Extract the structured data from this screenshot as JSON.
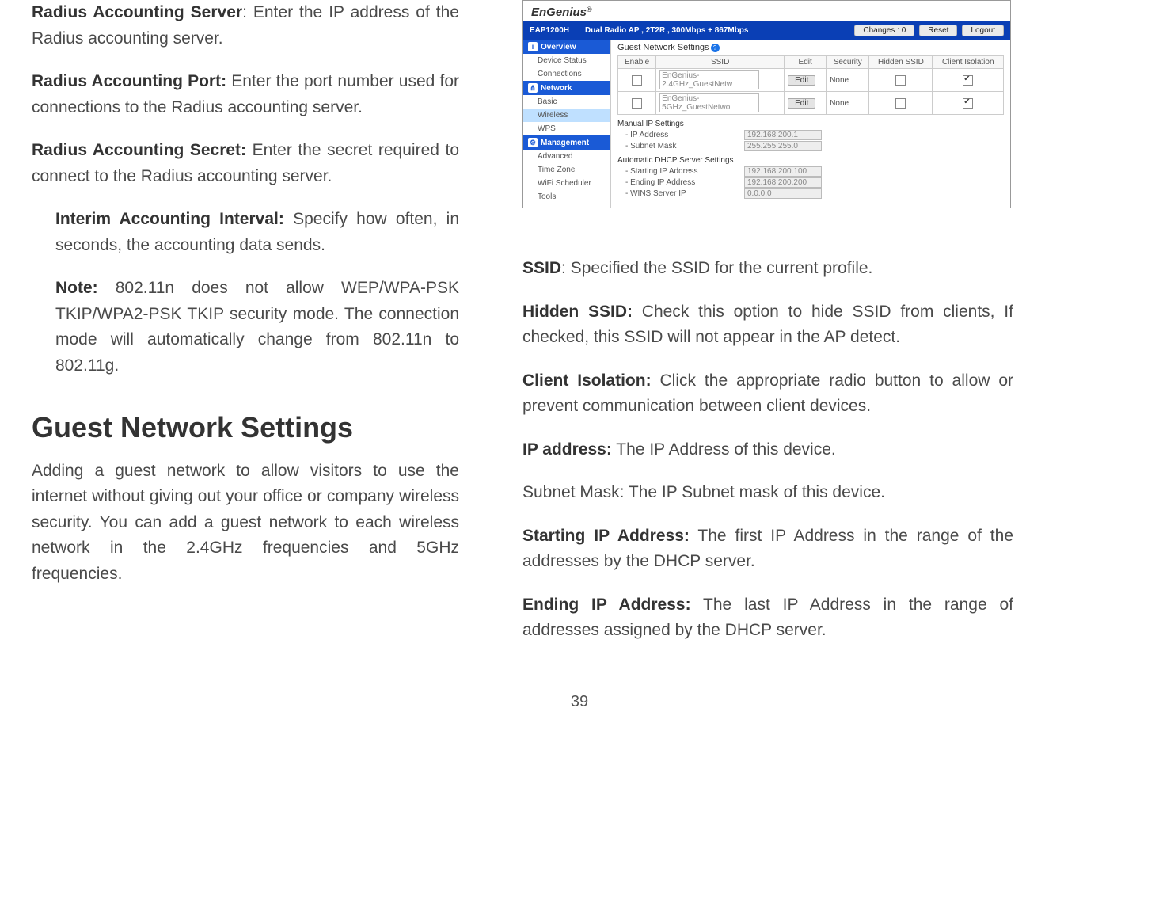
{
  "left": {
    "radius_server": {
      "label": "Radius Accounting Server",
      "text": ": Enter the IP address of the Radius accounting server."
    },
    "radius_port": {
      "label": "Radius Accounting Port:",
      "text": " Enter the port number used for connections to the Radius accounting server."
    },
    "radius_secret": {
      "label": "Radius Accounting Secret:",
      "text": " Enter the secret required to connect to the Radius accounting server."
    },
    "interim": {
      "label": "Interim Accounting Interval:",
      "text": " Specify how often, in seconds, the accounting data sends."
    },
    "note": {
      "label": "Note:",
      "text": " 802.11n does not allow WEP/WPA-PSK TKIP/WPA2-PSK TKIP security mode. The connection mode will automatically change from 802.11n to 802.11g."
    },
    "h2": "Guest Network Settings",
    "guest_intro": "Adding a guest network to allow visitors to use the internet without giving out your office or company wireless security. You can add a guest network to each wireless network in the 2.4GHz frequencies and 5GHz frequencies."
  },
  "right": {
    "ssid": {
      "label": "SSID",
      "text": ": Specified the SSID for the current profile."
    },
    "hidden": {
      "label": "Hidden SSID:",
      "text": " Check this option to hide SSID from clients, If checked, this SSID will not appear in the AP detect."
    },
    "isolation": {
      "label": "Client Isolation:",
      "text": " Click the appropriate radio button to allow or prevent communication between client devices."
    },
    "ip": {
      "label": "IP address:",
      "text": " The IP Address of this device."
    },
    "mask": {
      "text": "Subnet Mask: The IP Subnet mask of this device."
    },
    "start": {
      "label": "Starting IP Address:",
      "text": " The first IP Address in the range of the addresses by the DHCP server."
    },
    "end": {
      "label": "Ending IP Address:",
      "text": " The last IP Address in the range of addresses assigned by the DHCP server."
    }
  },
  "shot": {
    "brand": {
      "bold": "EnGenius",
      "reg": "®"
    },
    "bar": {
      "model": "EAP1200H",
      "mode": "Dual Radio AP , 2T2R , 300Mbps + 867Mbps",
      "changes": "Changes : 0",
      "reset": "Reset",
      "logout": "Logout"
    },
    "nav": {
      "s1": "Overview",
      "s1a": "Device Status",
      "s1b": "Connections",
      "s2": "Network",
      "s2a": "Basic",
      "s2b": "Wireless",
      "s2c": "WPS",
      "s3": "Management",
      "s3a": "Advanced",
      "s3b": "Time Zone",
      "s3c": "WiFi Scheduler",
      "s3d": "Tools"
    },
    "panel": {
      "title": "Guest Network Settings",
      "th": {
        "enable": "Enable",
        "ssid": "SSID",
        "edit": "Edit",
        "security": "Security",
        "hidden": "Hidden SSID",
        "iso": "Client Isolation"
      },
      "rows": [
        {
          "ssid": "EnGenius-2.4GHz_GuestNetw",
          "edit": "Edit",
          "sec": "None",
          "hidden": false,
          "iso": true
        },
        {
          "ssid": "EnGenius-5GHz_GuestNetwo",
          "edit": "Edit",
          "sec": "None",
          "hidden": false,
          "iso": true
        }
      ],
      "manual": "Manual IP Settings",
      "ip_k": "- IP Address",
      "ip_v": "192.168.200.1",
      "mask_k": "- Subnet Mask",
      "mask_v": "255.255.255.0",
      "dhcp": "Automatic DHCP Server Settings",
      "start_k": "- Starting IP Address",
      "start_v": "192.168.200.100",
      "end_k": "- Ending IP Address",
      "end_v": "192.168.200.200",
      "wins_k": "- WINS Server IP",
      "wins_v": "0.0.0.0"
    }
  },
  "pagenum": "39"
}
